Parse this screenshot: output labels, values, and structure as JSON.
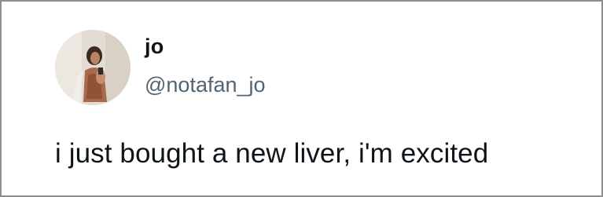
{
  "tweet": {
    "display_name": "jo",
    "handle": "@notafan_jo",
    "text": "i just bought a new liver, i'm excited",
    "avatar_icon": "profile-photo"
  },
  "colors": {
    "text": "#0f1419",
    "handle": "#536471",
    "border": "#8e8e8e"
  }
}
